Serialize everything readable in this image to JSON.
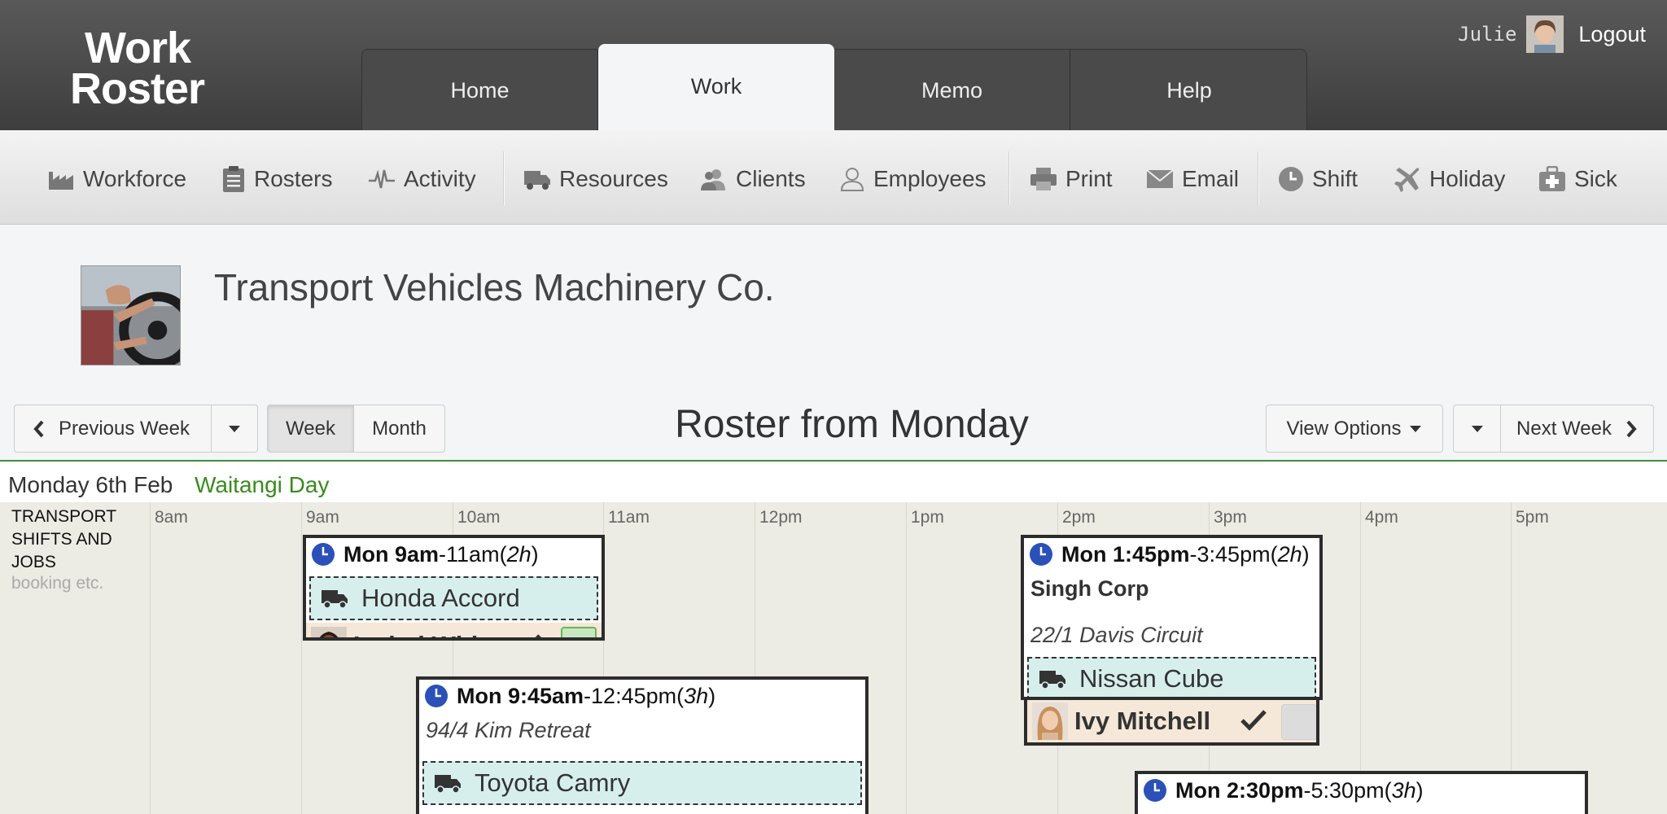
{
  "header": {
    "logo_line1": "Work",
    "logo_line2": "Roster",
    "tabs": [
      {
        "label": "Home"
      },
      {
        "label": "Work"
      },
      {
        "label": "Memo"
      },
      {
        "label": "Help"
      }
    ],
    "active_tab": "Work",
    "user_name": "Julie",
    "logout_label": "Logout"
  },
  "toolbar": {
    "items": [
      {
        "label": "Workforce",
        "icon": "factory-icon"
      },
      {
        "label": "Rosters",
        "icon": "clipboard-icon"
      },
      {
        "label": "Activity",
        "icon": "pulse-icon"
      },
      {
        "label": "Resources",
        "icon": "truck-icon"
      },
      {
        "label": "Clients",
        "icon": "users-icon"
      },
      {
        "label": "Employees",
        "icon": "user-icon"
      },
      {
        "label": "Print",
        "icon": "printer-icon"
      },
      {
        "label": "Email",
        "icon": "envelope-icon"
      },
      {
        "label": "Shift",
        "icon": "clock-icon"
      },
      {
        "label": "Holiday",
        "icon": "plane-icon"
      },
      {
        "label": "Sick",
        "icon": "medkit-icon"
      }
    ]
  },
  "company": {
    "name": "Transport Vehicles Machinery Co."
  },
  "nav": {
    "prev_week": "Previous Week",
    "week": "Week",
    "month": "Month",
    "title": "Roster from Monday",
    "view_options": "View Options",
    "next_week": "Next Week"
  },
  "day": {
    "name": "Monday 6th Feb",
    "holiday": "Waitangi Day"
  },
  "timeline": {
    "row_label_lines": [
      "TRANSPORT",
      "SHIFTS AND",
      "JOBS"
    ],
    "row_sublabel": "booking etc.",
    "hours": [
      "8am",
      "9am",
      "10am",
      "11am",
      "12pm",
      "1pm",
      "2pm",
      "3pm",
      "4pm",
      "5pm"
    ]
  },
  "shifts": [
    {
      "start": "Mon 9am",
      "end": "-11am",
      "duration_open": " (",
      "duration": "2h",
      "duration_close": ")",
      "client": "",
      "address": "",
      "vehicle": "Honda Accord",
      "employee": "Isabel White",
      "status_color": "#c7e8bf"
    },
    {
      "start": "Mon 9:45am",
      "end": "-12:45pm",
      "duration_open": " (",
      "duration": "3h",
      "duration_close": ")",
      "client": "",
      "address": "94/4 Kim Retreat",
      "vehicle": "Toyota Camry",
      "employee": "",
      "status_color": ""
    },
    {
      "start": "Mon 1:45pm",
      "end": "-3:45pm",
      "duration_open": " (",
      "duration": "2h",
      "duration_close": ")",
      "client": "Singh Corp",
      "address": "22/1 Davis Circuit",
      "vehicle": "Nissan Cube",
      "employee": "Ivy Mitchell",
      "status_color": "#dcdcdc"
    },
    {
      "start": "Mon 2:30pm",
      "end": "-5:30pm",
      "duration_open": " (",
      "duration": "3h",
      "duration_close": ")",
      "client": "",
      "address": "",
      "vehicle": "",
      "employee": "",
      "status_color": ""
    }
  ],
  "colors": {
    "holiday_green": "#3a8b1e",
    "clock_blue": "#2b50b8",
    "vehicle_bg": "#d7efec",
    "employee_bg": "#f5e8d8"
  }
}
